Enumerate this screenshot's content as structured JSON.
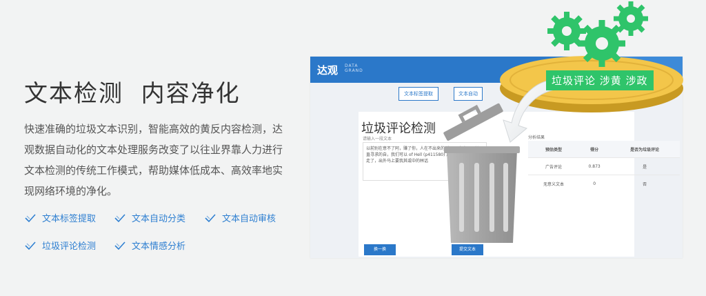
{
  "hero": {
    "title": "文本检测  内容净化",
    "description": "快速准确的垃圾文本识别，智能高效的黄反内容检测，达观数据自动化的文本处理服务改变了以往业界靠人力进行文本检测的传统工作模式，帮助媒体低成本、高效率地实现网络环境的净化。"
  },
  "features": [
    {
      "label": "文本标签提取",
      "icon": "check-icon"
    },
    {
      "label": "文本自动分类",
      "icon": "check-icon"
    },
    {
      "label": "文本自动审核",
      "icon": "check-icon"
    },
    {
      "label": "垃圾评论检测",
      "icon": "check-icon"
    },
    {
      "label": "文本情感分析",
      "icon": "check-icon"
    }
  ],
  "mock": {
    "logo": "达观",
    "logo_sub_1": "DATA",
    "logo_sub_2": "GRAND",
    "tabs": [
      "文本标签提取",
      "文本自动"
    ],
    "card_title": "垃圾评论检测",
    "card_subtitle": "请输入一段文本",
    "textarea_text": "以前别在意不了阿，赚了你，人在不出来的 认开了自会吧，她一直寻求的自，我们可以 of Hell (p411580) 后 (869456017) 走了，出外马上要我其或中的林话",
    "result_label": "分析结果",
    "table_headers": [
      "预估类型",
      "得分",
      "是否为垃圾评论"
    ],
    "table_rows": [
      [
        "广告评论",
        "0.873",
        "是"
      ],
      [
        "无意义文本",
        "0",
        "否"
      ]
    ],
    "btn_primary": "换一换",
    "btn_secondary": "提交文本"
  },
  "badge": {
    "text": "垃圾评论  涉黄  涉政"
  },
  "colors": {
    "accent": "#2e7fd1",
    "mock_blue": "#2b78c9",
    "gear_green": "#2fc46a",
    "disk_yellow": "#f3c64a",
    "trash_gray": "#9c9c9c"
  }
}
